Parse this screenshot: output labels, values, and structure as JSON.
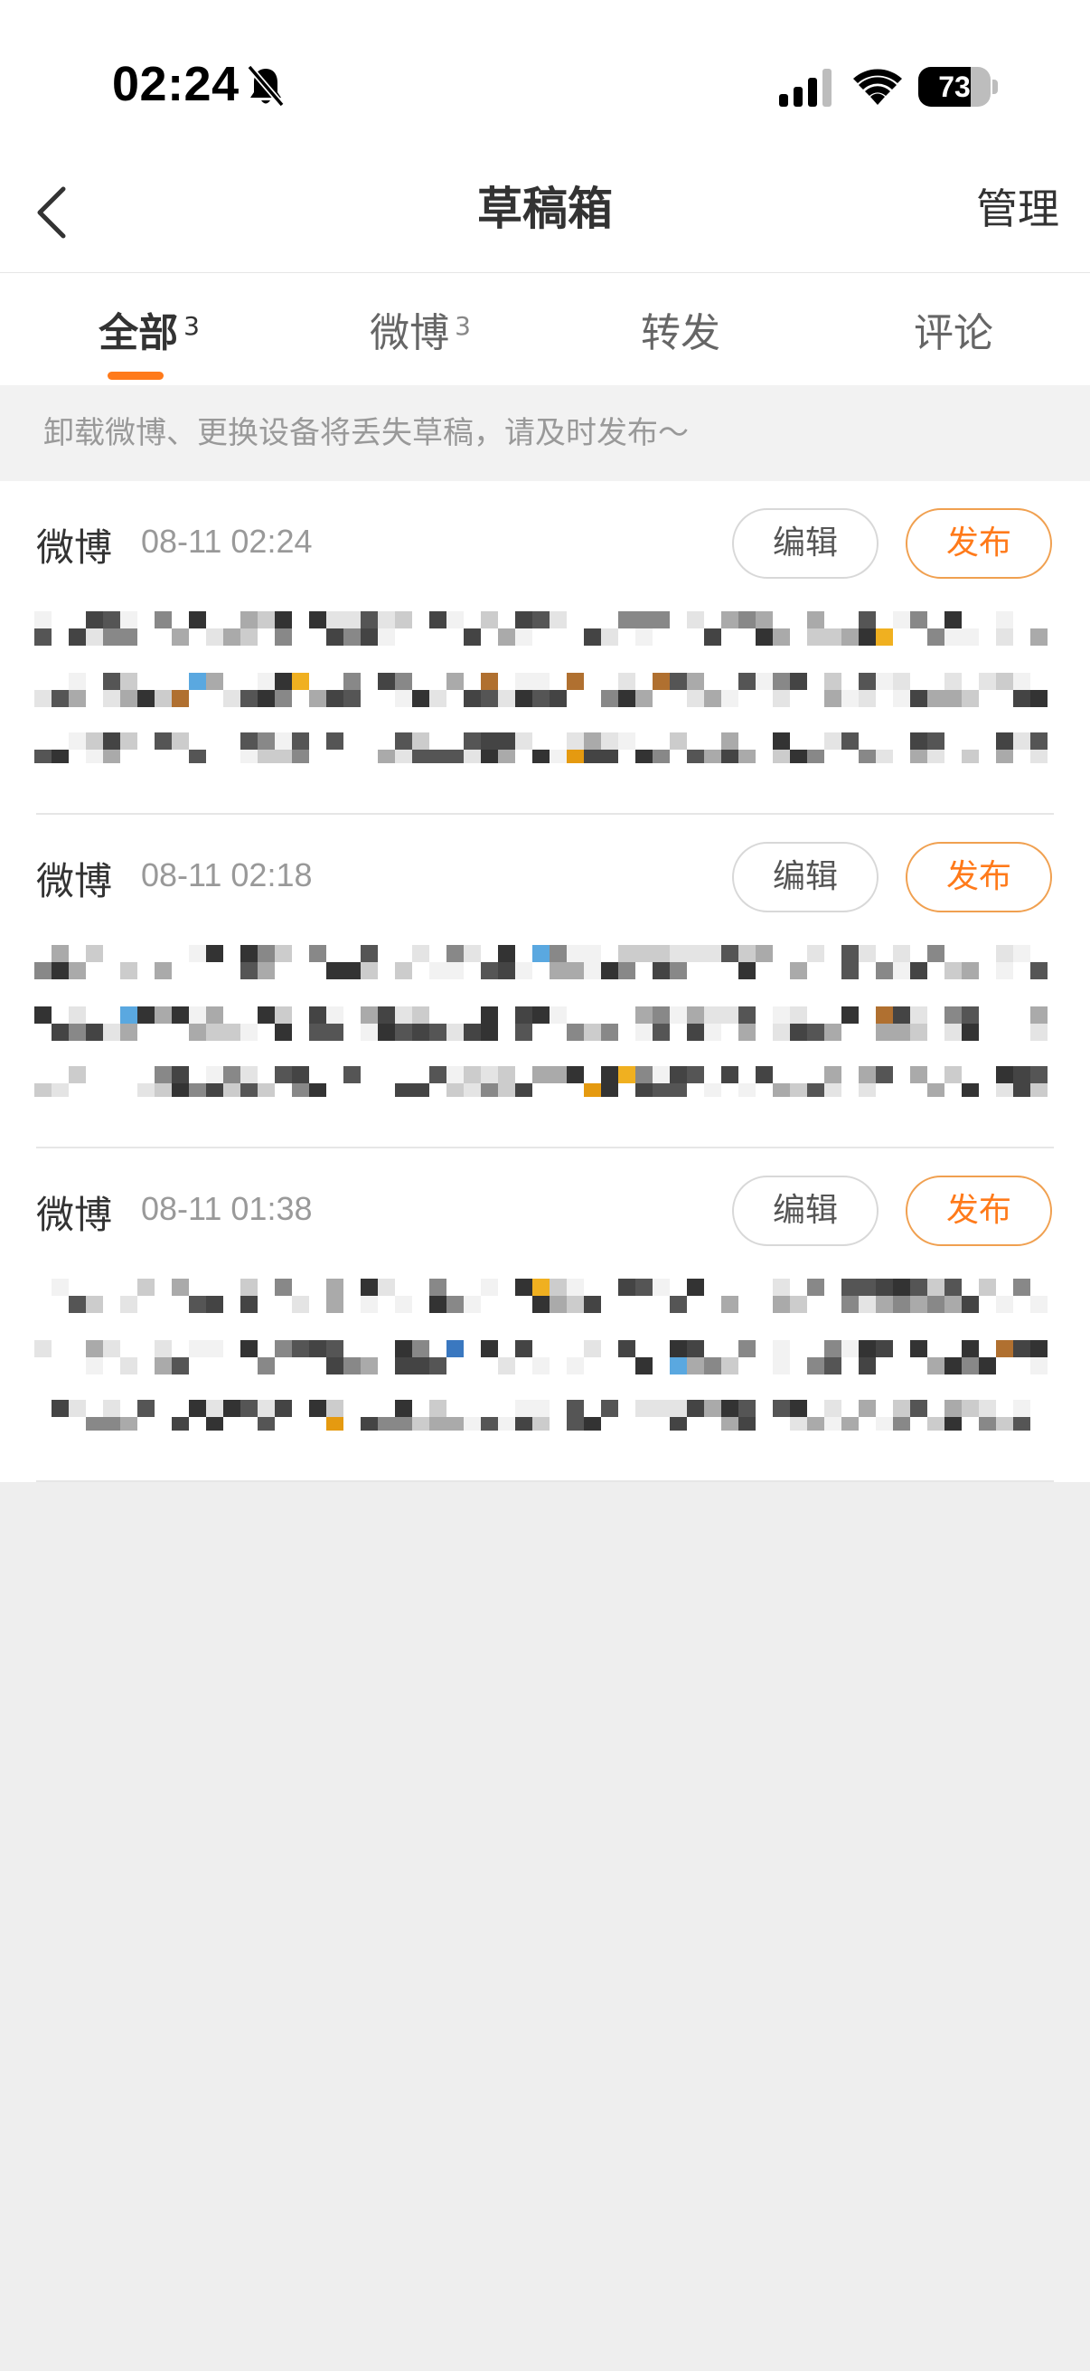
{
  "status_bar": {
    "time": "02:24",
    "battery_level": 73,
    "battery_label": "73"
  },
  "nav": {
    "title": "草稿箱",
    "right_action": "管理"
  },
  "tabs": [
    {
      "label": "全部",
      "count": "3",
      "active": true
    },
    {
      "label": "微博",
      "count": "3",
      "active": false
    },
    {
      "label": "转发",
      "count": "",
      "active": false
    },
    {
      "label": "评论",
      "count": "",
      "active": false
    }
  ],
  "notice": "卸载微博、更换设备将丢失草稿，请及时发布～",
  "drafts": [
    {
      "type": "微博",
      "time": "08-11 02:24",
      "edit_label": "编辑",
      "publish_label": "发布"
    },
    {
      "type": "微博",
      "time": "08-11 02:18",
      "edit_label": "编辑",
      "publish_label": "发布"
    },
    {
      "type": "微博",
      "time": "08-11 01:38",
      "edit_label": "编辑",
      "publish_label": "发布"
    }
  ],
  "colors": {
    "accent": "#ff7a1a",
    "text_primary": "#333333",
    "text_secondary": "#999999",
    "background": "#eeeeee"
  },
  "icons": {
    "back": "chevron-left-icon",
    "mute": "bell-slash-icon",
    "signal": "cellular-signal-icon",
    "wifi": "wifi-icon"
  }
}
